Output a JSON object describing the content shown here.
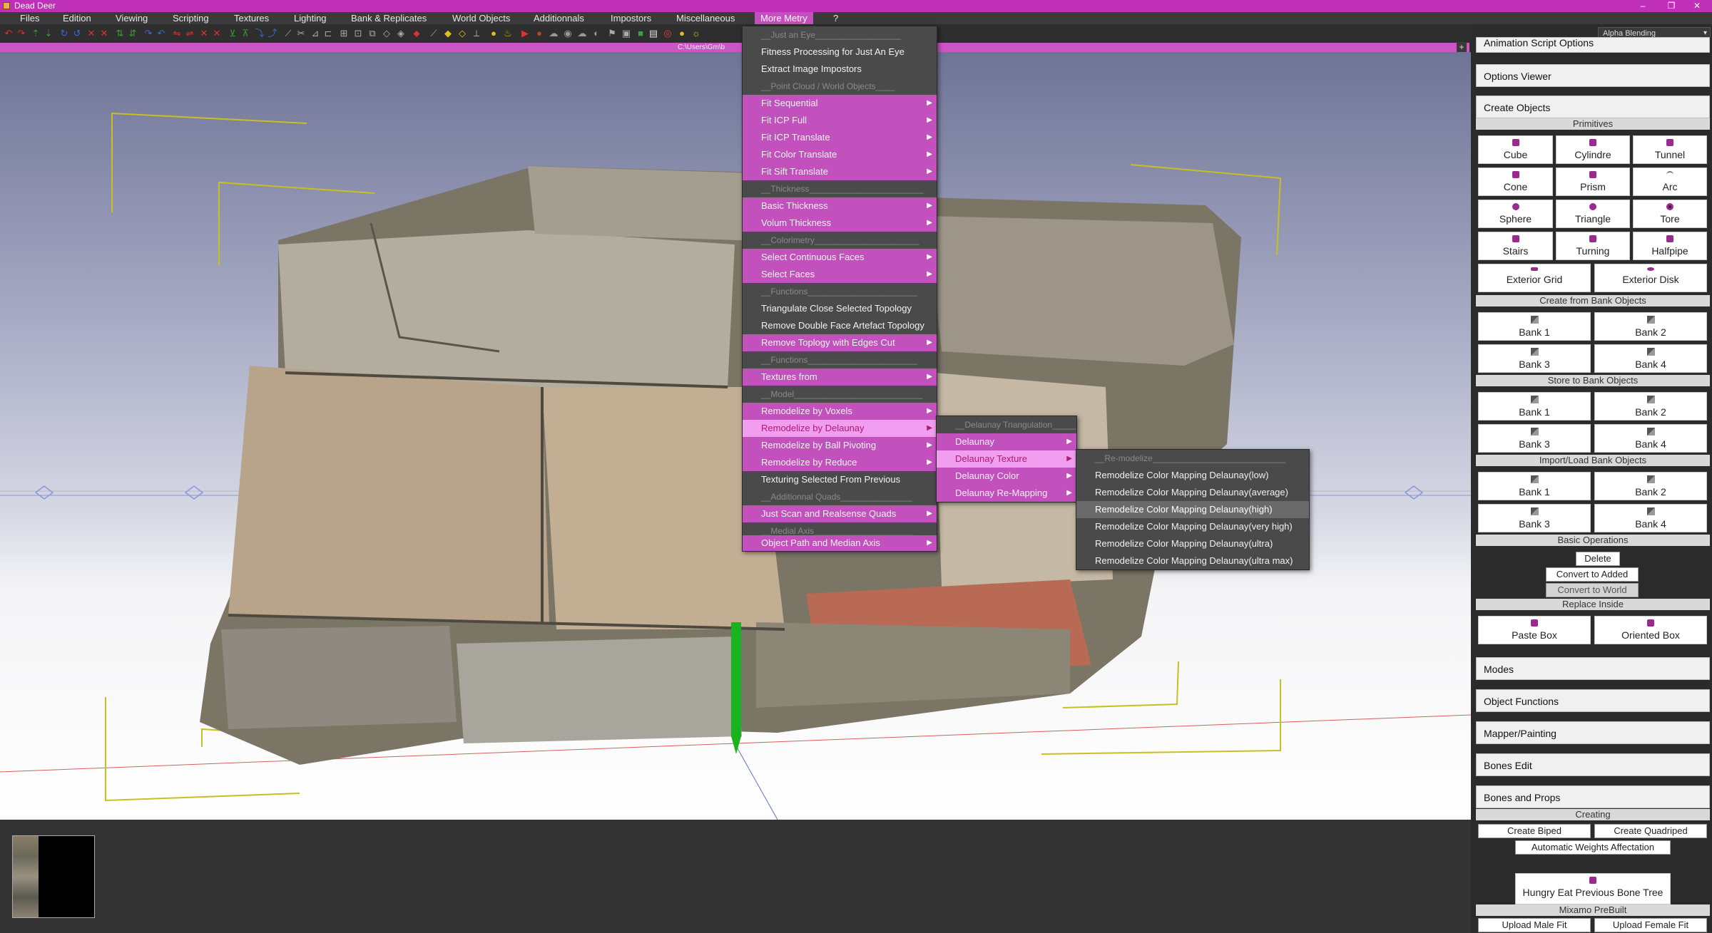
{
  "window": {
    "title": "Dead Deer",
    "controls": [
      "–",
      "❐",
      "✕"
    ]
  },
  "menubar": [
    "Files",
    "Edition",
    "Viewing",
    "Scripting",
    "Textures",
    "Lighting",
    "Bank & Replicates",
    "World Objects",
    "Additionnals",
    "Impostors",
    "Miscellaneous",
    "More Metry",
    "?"
  ],
  "toolbar": {
    "blend_mode": "Alpha Blending"
  },
  "pathbar": {
    "path": "C:\\Users\\Gm\\b",
    "plus": "+"
  },
  "more_metry_menu": [
    {
      "label": "__Just an Eye__________________",
      "kind": "sep"
    },
    {
      "label": "Fitness Processing for Just An Eye",
      "kind": "item"
    },
    {
      "label": "Extract Image Impostors",
      "kind": "item"
    },
    {
      "label": "__Point Cloud / World Objects____",
      "kind": "sep"
    },
    {
      "label": "Fit Sequential",
      "kind": "sub"
    },
    {
      "label": "Fit ICP Full",
      "kind": "sub"
    },
    {
      "label": "Fit ICP Translate",
      "kind": "sub"
    },
    {
      "label": "Fit Color Translate",
      "kind": "sub"
    },
    {
      "label": "Fit Sift Translate",
      "kind": "sub"
    },
    {
      "label": "__Thickness________________________",
      "kind": "sep"
    },
    {
      "label": "Basic Thickness",
      "kind": "sub"
    },
    {
      "label": "Volum Thickness",
      "kind": "sub"
    },
    {
      "label": "__Colorimetry______________________",
      "kind": "sep"
    },
    {
      "label": "Select Continuous Faces",
      "kind": "sub"
    },
    {
      "label": "Select Faces",
      "kind": "sub"
    },
    {
      "label": "__Functions_______________________",
      "kind": "sep"
    },
    {
      "label": "Triangulate Close Selected Topology",
      "kind": "item"
    },
    {
      "label": "Remove Double Face Artefact Topology",
      "kind": "item"
    },
    {
      "label": "Remove Toplogy with Edges Cut",
      "kind": "sub"
    },
    {
      "label": "__Functions_______________________",
      "kind": "sep"
    },
    {
      "label": "Textures from",
      "kind": "sub"
    },
    {
      "label": "__Model___________________________",
      "kind": "sep"
    },
    {
      "label": "Remodelize by Voxels",
      "kind": "sub"
    },
    {
      "label": "Remodelize by Delaunay",
      "kind": "active"
    },
    {
      "label": "Remodelize by Ball Pivoting",
      "kind": "sub"
    },
    {
      "label": "Remodelize by Reduce",
      "kind": "sub"
    },
    {
      "label": "Texturing Selected From Previous",
      "kind": "item"
    },
    {
      "label": "__Additionnal Quads_______________",
      "kind": "sep"
    },
    {
      "label": "Just Scan and Realsense Quads",
      "kind": "sub"
    },
    {
      "label": "__Medial Axis_____________________",
      "kind": "sep"
    },
    {
      "label": "Object Path and Median Axis",
      "kind": "sub"
    }
  ],
  "delaunay_menu": [
    {
      "label": "__Delaunay Triangulation_____",
      "kind": "sep"
    },
    {
      "label": "Delaunay",
      "kind": "sub"
    },
    {
      "label": "Delaunay Texture",
      "kind": "active"
    },
    {
      "label": "Delaunay Color",
      "kind": "sub"
    },
    {
      "label": "Delaunay Re-Mapping",
      "kind": "sub"
    }
  ],
  "remodelize_menu": [
    {
      "label": "__Re-modelize____________________________",
      "kind": "sep"
    },
    {
      "label": "Remodelize Color Mapping Delaunay(low)",
      "kind": "item"
    },
    {
      "label": "Remodelize Color Mapping Delaunay(average)",
      "kind": "item"
    },
    {
      "label": "Remodelize Color Mapping Delaunay(high)",
      "kind": "hover"
    },
    {
      "label": "Remodelize Color Mapping Delaunay(very high)",
      "kind": "item"
    },
    {
      "label": "Remodelize Color Mapping Delaunay(ultra)",
      "kind": "item"
    },
    {
      "label": "Remodelize Color Mapping Delaunay(ultra max)",
      "kind": "item"
    }
  ],
  "panel": {
    "animation_script": "Animation Script Options",
    "options_viewer": "Options Viewer",
    "create_objects": "Create Objects",
    "primitives_label": "Primitives",
    "primitives": [
      "Cube",
      "Cylindre",
      "Tunnel",
      "Cone",
      "Prism",
      "Arc",
      "Sphere",
      "Triangle",
      "Tore",
      "Stairs",
      "Turning",
      "Halfpipe"
    ],
    "exterior": [
      "Exterior Grid",
      "Exterior Disk"
    ],
    "create_from_bank": "Create from Bank Objects",
    "store_to_bank": "Store to Bank Objects",
    "import_load_bank": "Import/Load Bank Objects",
    "banks": [
      "Bank 1",
      "Bank 2",
      "Bank 3",
      "Bank 4"
    ],
    "basic_ops_label": "Basic Operations",
    "delete": "Delete",
    "convert_added": "Convert to Added",
    "convert_world": "Convert to World",
    "replace_inside": "Replace Inside",
    "paste_box": "Paste Box",
    "oriented_box": "Oriented Box",
    "modes": "Modes",
    "object_functions": "Object Functions",
    "mapper_painting": "Mapper/Painting",
    "bones_edit": "Bones Edit",
    "bones_props": "Bones and Props",
    "creating_label": "Creating",
    "create_biped": "Create Biped",
    "create_quadriped": "Create Quadriped",
    "auto_weights": "Automatic Weights Affectation",
    "hungry_eat": "Hungry Eat Previous Bone Tree",
    "mixamo_label": "Mixamo PreBuilt",
    "upload_male": "Upload Male Fit",
    "upload_female": "Upload Female Fit"
  }
}
